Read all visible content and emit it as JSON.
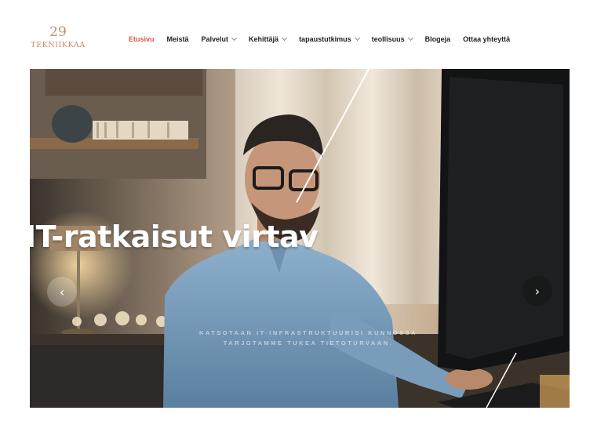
{
  "logo": {
    "number": "29",
    "wordmark": "TEKNIIKKAA"
  },
  "nav": [
    {
      "label": "Etusivu",
      "active": true,
      "dropdown": false
    },
    {
      "label": "Meistä",
      "active": false,
      "dropdown": false
    },
    {
      "label": "Palvelut",
      "active": false,
      "dropdown": true
    },
    {
      "label": "Kehittäjä",
      "active": false,
      "dropdown": true
    },
    {
      "label": "tapaustutkimus",
      "active": false,
      "dropdown": true
    },
    {
      "label": "teollisuus",
      "active": false,
      "dropdown": true
    },
    {
      "label": "Blogeja",
      "active": false,
      "dropdown": false
    },
    {
      "label": "Ottaa yhteyttä",
      "active": false,
      "dropdown": false
    }
  ],
  "hero": {
    "title": "IT-ratkaisut virtav",
    "subtitle_line1": "KATSOTAAN IT-INFRASTRUKTUURISI KUNNOSSA",
    "subtitle_line2": "TARJOTAMME TUKEA TIETOTURVAAN.",
    "prev_icon": "chevron-left-icon",
    "next_icon": "chevron-right-icon",
    "prev_glyph": "‹",
    "next_glyph": "›"
  },
  "colors": {
    "accent": "#e05546",
    "logo": "#c9896a",
    "text": "#222222"
  }
}
